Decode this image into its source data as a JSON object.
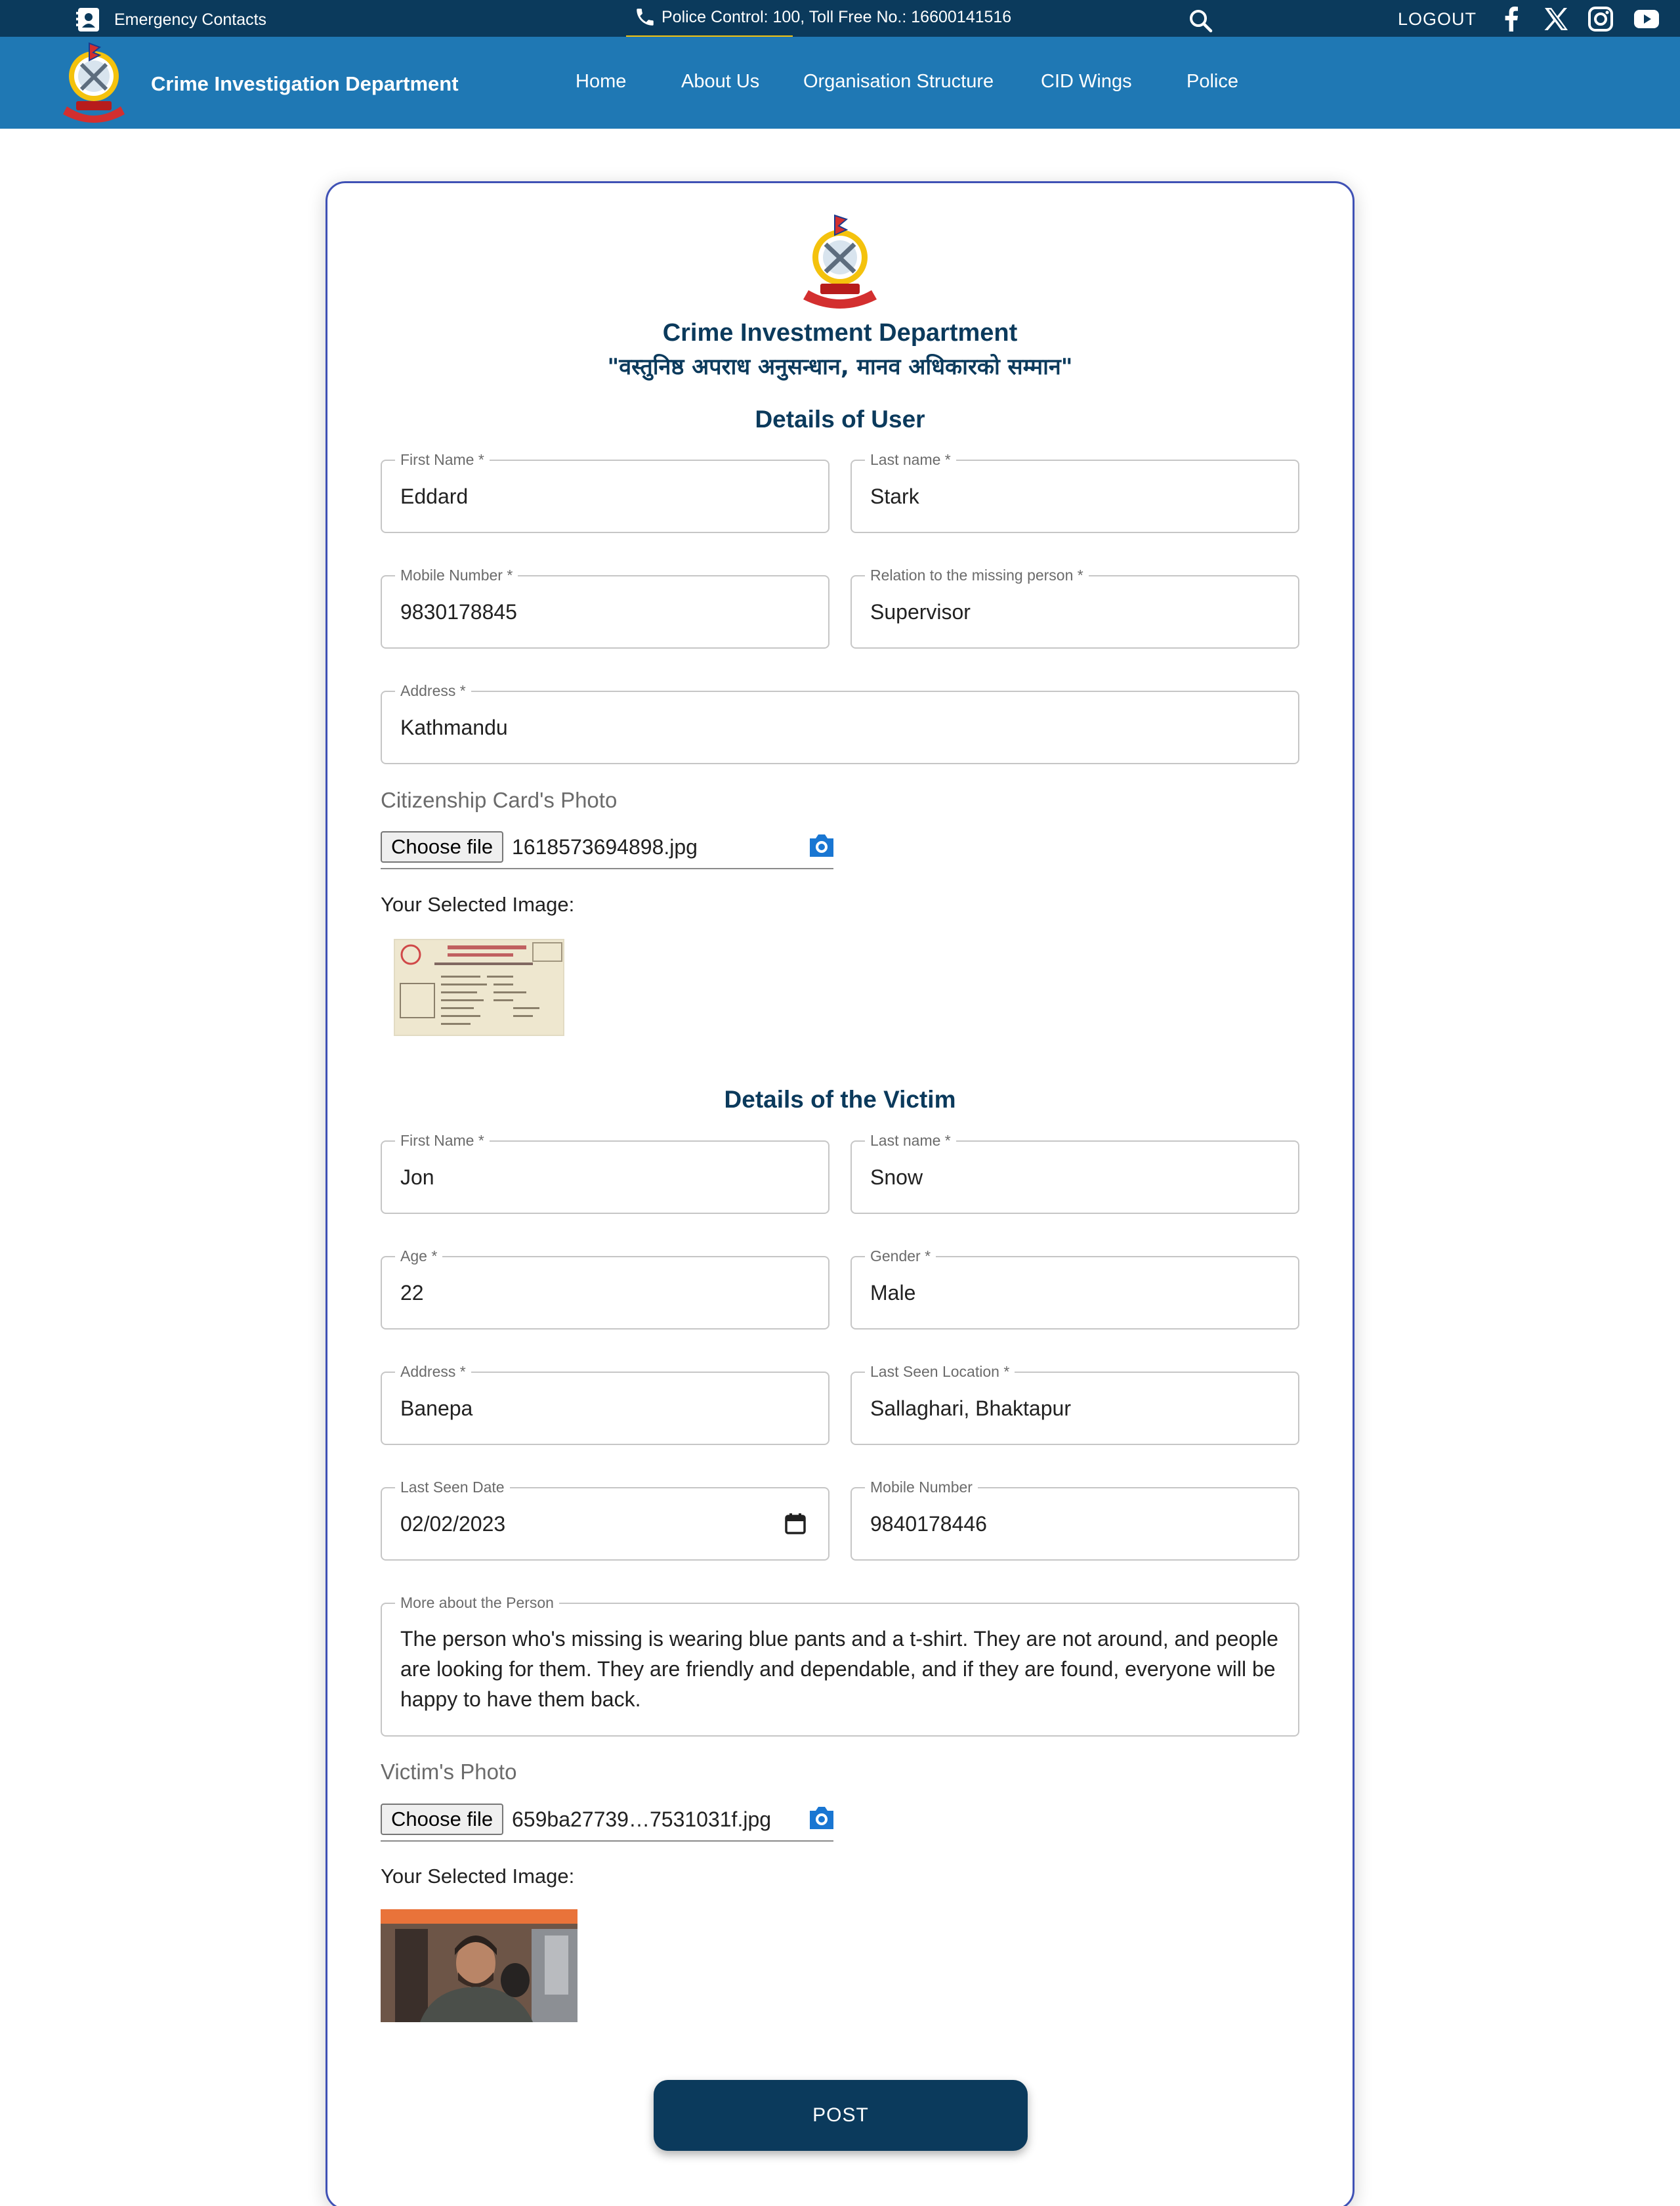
{
  "topbar": {
    "emergency_label": "Emergency Contacts",
    "police_contact": "Police Control: 100, Toll Free No.: 16600141516",
    "logout_label": "LOGOUT",
    "social_icons": [
      "facebook-icon",
      "x-icon",
      "instagram-icon",
      "youtube-icon"
    ]
  },
  "navbar": {
    "brand": "Crime Investigation Department",
    "items": [
      "Home",
      "About Us",
      "Organisation Structure",
      "CID Wings",
      "Police"
    ]
  },
  "card": {
    "title": "Crime Investment Department",
    "motto": "\"वस्तुनिष्ठ अपराध अनुसन्धान, मानव अधिकारको सम्मान\""
  },
  "user_section": {
    "title": "Details of User",
    "first_name": {
      "label": "First Name *",
      "value": "Eddard"
    },
    "last_name": {
      "label": "Last name *",
      "value": "Stark"
    },
    "mobile": {
      "label": "Mobile Number *",
      "value": "9830178845"
    },
    "relation": {
      "label": "Relation to the missing person *",
      "value": "Supervisor"
    },
    "address": {
      "label": "Address *",
      "value": "Kathmandu"
    },
    "citizenship_label": "Citizenship Card's Photo",
    "choose_file": "Choose file",
    "file_name": "1618573694898.jpg",
    "selected_label": "Your Selected Image:"
  },
  "victim_section": {
    "title": "Details of the Victim",
    "first_name": {
      "label": "First Name *",
      "value": "Jon"
    },
    "last_name": {
      "label": "Last name *",
      "value": "Snow"
    },
    "age": {
      "label": "Age *",
      "value": "22"
    },
    "gender": {
      "label": "Gender *",
      "value": "Male"
    },
    "address": {
      "label": "Address *",
      "value": "Banepa"
    },
    "last_seen_location": {
      "label": "Last Seen Location *",
      "value": "Sallaghari, Bhaktapur"
    },
    "last_seen_date": {
      "label": "Last Seen Date",
      "value": "02/02/2023"
    },
    "mobile": {
      "label": "Mobile Number",
      "value": "9840178446"
    },
    "more": {
      "label": "More about the Person",
      "value": "The person who's missing is wearing blue pants and a t-shirt. They are not around, and people are looking for them. They are friendly and dependable, and if they are found, everyone will be happy to have them back."
    },
    "photo_label": "Victim's Photo",
    "choose_file": "Choose file",
    "file_name": "659ba27739…7531031f.jpg",
    "selected_label": "Your Selected Image:"
  },
  "post_label": "POST",
  "colors": {
    "topbar": "#0b3a5c",
    "navbar": "#1f78b4",
    "accent_yellow": "#f4c20d",
    "heading": "#0b3a5c",
    "card_border": "#3f51b5",
    "camera": "#1976d2"
  }
}
